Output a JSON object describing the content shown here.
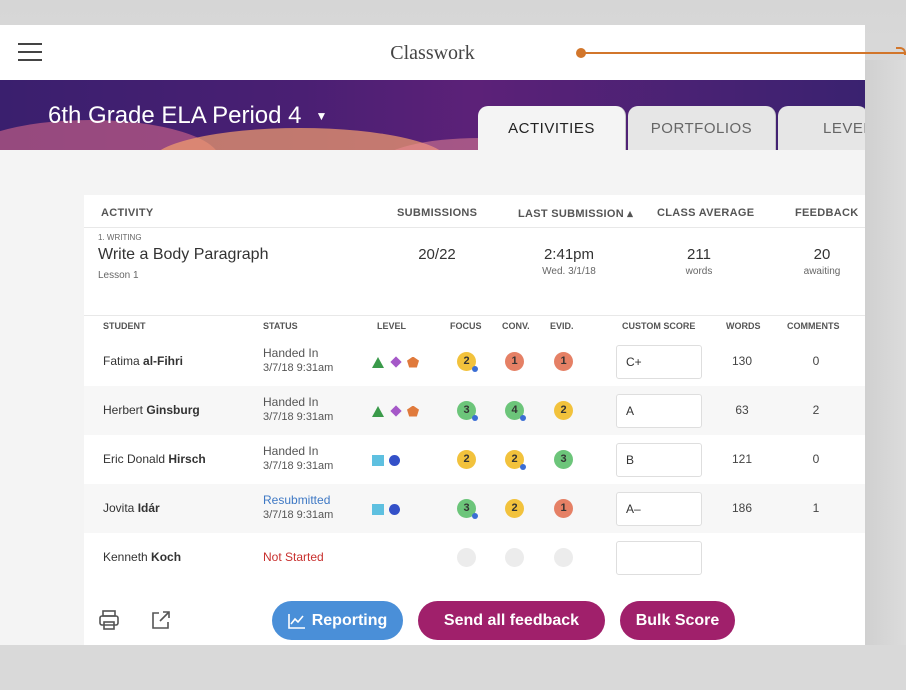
{
  "app": {
    "title": "Classwork"
  },
  "colors": {
    "pointer": "#d2762b",
    "banner": "#4a1f73",
    "reporting": "#4a8fd8",
    "primary": "#a0206b"
  },
  "class_header": {
    "title": "6th Grade ELA Period 4",
    "dropdown_icon": "caret-down-icon"
  },
  "tabs": [
    {
      "label": "ACTIVITIES",
      "active": true
    },
    {
      "label": "PORTFOLIOS",
      "active": false
    },
    {
      "label": "LEVEL",
      "active": false
    }
  ],
  "table": {
    "headers": {
      "activity": "ACTIVITY",
      "submissions": "SUBMISSIONS",
      "last_submission": "LAST SUBMISSION ▴",
      "class_average": "CLASS AVERAGE",
      "feedback": "FEEDBACK"
    },
    "activity": {
      "category": "1. WRITING",
      "name": "Write a Body Paragraph",
      "lesson": "Lesson 1",
      "submissions": "20/22",
      "last_time": "2:41pm",
      "last_date": "Wed. 3/1/18",
      "avg_value": "211",
      "avg_unit": "words",
      "feedback_value": "20",
      "feedback_unit": "awaiting"
    },
    "subheaders": {
      "student": "STUDENT",
      "status": "STATUS",
      "level": "LEVEL",
      "focus": "FOCUS",
      "conv": "CONV.",
      "evid": "EVID.",
      "custom_score": "CUSTOM SCORE",
      "words": "WORDS",
      "comments": "COMMENTS"
    },
    "students": [
      {
        "first": "Fatima ",
        "last": "al-Fihri",
        "status": "Handed In",
        "date": "3/7/18  9:31am",
        "levels": [
          "triangle",
          "diamond",
          "pentagon"
        ],
        "focus": "2",
        "conv": "1",
        "evid": "1",
        "score": "C+",
        "words": "130",
        "comments": "0"
      },
      {
        "first": "Herbert ",
        "last": "Ginsburg",
        "status": "Handed In",
        "date": "3/7/18  9:31am",
        "levels": [
          "triangle",
          "diamond",
          "pentagon"
        ],
        "focus": "3",
        "conv": "4",
        "evid": "2",
        "score": "A",
        "words": "63",
        "comments": "2"
      },
      {
        "first": "Eric Donald ",
        "last": "Hirsch",
        "status": "Handed In",
        "date": "3/7/18  9:31am",
        "levels": [
          "square",
          "circle"
        ],
        "focus": "2",
        "conv": "2",
        "evid": "3",
        "score": "B",
        "words": "121",
        "comments": "0"
      },
      {
        "first": "Jovita ",
        "last": "Idár",
        "status": "Resubmitted",
        "date": "3/7/18  9:31am",
        "levels": [
          "square",
          "circle"
        ],
        "focus": "3",
        "conv": "2",
        "evid": "1",
        "score": "A–",
        "words": "186",
        "comments": "1"
      },
      {
        "first": "Kenneth ",
        "last": "Koch",
        "status": "Not Started",
        "date": "",
        "levels": [],
        "focus": "",
        "conv": "",
        "evid": "",
        "score": "",
        "words": "",
        "comments": ""
      }
    ]
  },
  "actions": {
    "print_icon": "printer-icon",
    "export_icon": "external-link-icon",
    "reporting": "Reporting",
    "send_feedback": "Send all feedback",
    "bulk_score": "Bulk Score"
  }
}
